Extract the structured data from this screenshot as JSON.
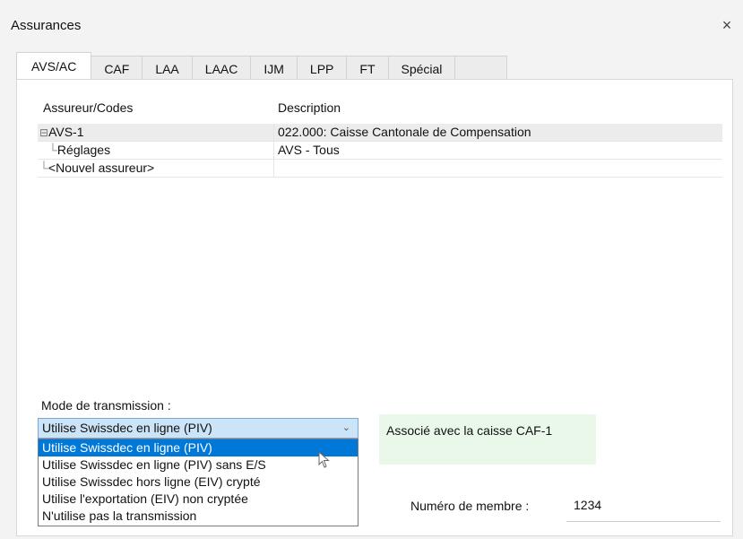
{
  "window": {
    "title": "Assurances",
    "close_glyph": "×"
  },
  "tabs": [
    {
      "label": "AVS/AC",
      "active": true
    },
    {
      "label": "CAF"
    },
    {
      "label": "LAA"
    },
    {
      "label": "LAAC"
    },
    {
      "label": "IJM"
    },
    {
      "label": "LPP"
    },
    {
      "label": "FT"
    },
    {
      "label": "Spécial"
    }
  ],
  "tree": {
    "headers": {
      "assureur": "Assureur/Codes",
      "description": "Description"
    },
    "rows": [
      {
        "expander": "⊟",
        "code": "AVS-1",
        "description": "022.000: Caisse Cantonale de Compensation"
      },
      {
        "code": "Réglages",
        "description": "AVS - Tous"
      },
      {
        "code": "<Nouvel assureur>",
        "description": ""
      }
    ]
  },
  "transmission": {
    "label": "Mode de transmission :",
    "selected": "Utilise Swissdec en ligne (PIV)",
    "options": [
      "Utilise Swissdec en ligne (PIV)",
      "Utilise Swissdec en ligne (PIV) sans E/S",
      "Utilise Swissdec hors ligne (EIV) crypté",
      "Utilise l'exportation (EIV) non cryptée",
      "N'utilise pas la transmission"
    ]
  },
  "assoc": {
    "text": "Associé avec la caisse CAF-1"
  },
  "member": {
    "label": "Numéro de membre :",
    "value": "1234"
  },
  "colors": {
    "accent": "#0078d7",
    "combo_bg": "#cce4f7",
    "assoc_bg": "#eaf8ea"
  }
}
